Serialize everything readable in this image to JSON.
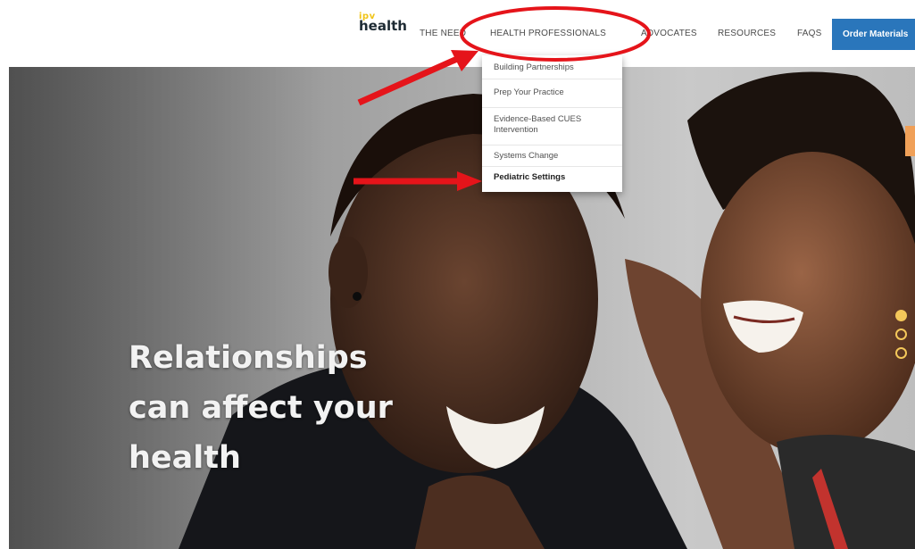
{
  "header": {
    "logo_top": "ipv",
    "logo_bottom": "health",
    "nav": {
      "the_need": "THE NEED",
      "health_professionals": "HEALTH PROFESSIONALS",
      "advocates": "ADVOCATES",
      "resources": "RESOURCES",
      "faqs": "FAQS"
    },
    "order_button": "Order Materials"
  },
  "dropdown": {
    "items": [
      {
        "label": "Building Partnerships"
      },
      {
        "label": "Prep Your Practice"
      },
      {
        "label": "Evidence-Based CUES Intervention"
      },
      {
        "label": "Systems Change"
      },
      {
        "label": "Pediatric Settings",
        "bold": true
      }
    ]
  },
  "hero": {
    "title_lines": [
      "Relationships",
      "can affect your",
      "health"
    ],
    "carousel_dots_active": 1,
    "carousel_dots_total": 3
  },
  "colors": {
    "order_button": "#2a76bb",
    "accent_yellow": "#f4c85a",
    "annotation_red": "#e5141a",
    "side_tab": "#f0a058"
  }
}
